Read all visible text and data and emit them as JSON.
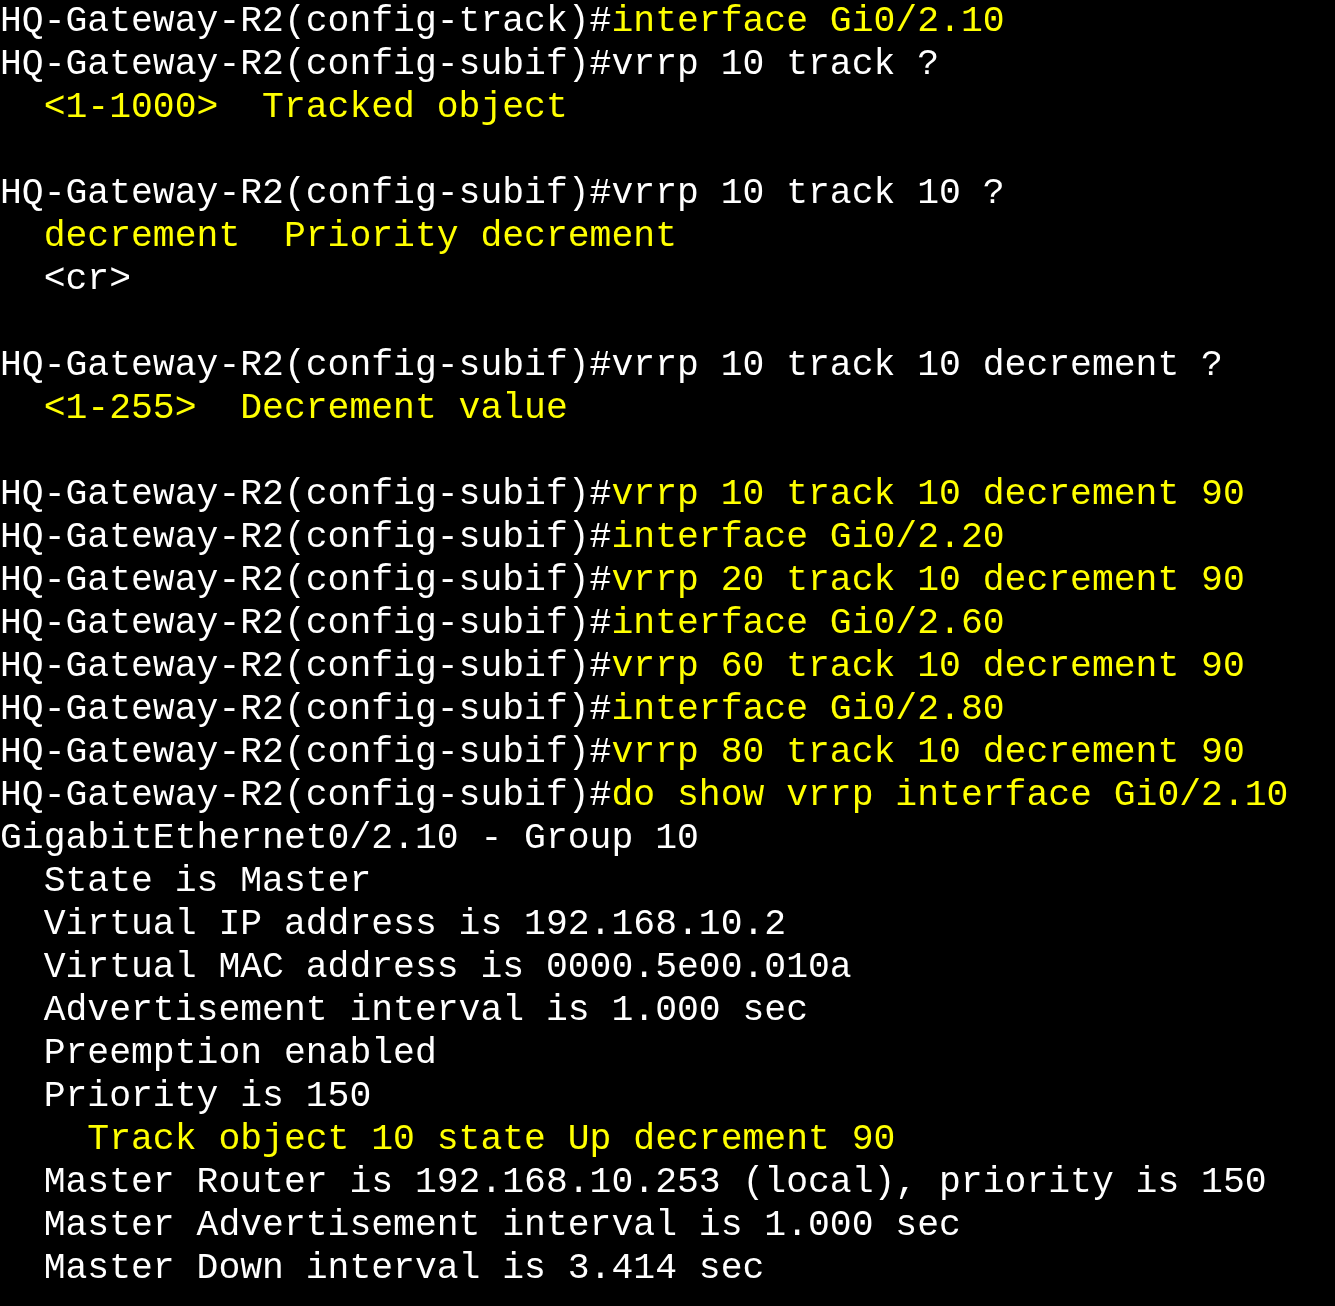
{
  "terminal": {
    "lines": [
      {
        "kind": "command",
        "prompt": "HQ-Gateway-R2(config-track)#",
        "command": "interface Gi0/2.10",
        "highlighted": true
      },
      {
        "kind": "command",
        "prompt": "HQ-Gateway-R2(config-subif)#",
        "command": "vrrp 10 track ?",
        "highlighted": false
      },
      {
        "kind": "output",
        "text": "  <1-1000>  Tracked object",
        "highlighted": true
      },
      {
        "kind": "blank"
      },
      {
        "kind": "command",
        "prompt": "HQ-Gateway-R2(config-subif)#",
        "command": "vrrp 10 track 10 ?",
        "highlighted": false
      },
      {
        "kind": "output",
        "text": "  decrement  Priority decrement",
        "highlighted": true
      },
      {
        "kind": "output",
        "text": "  <cr>",
        "highlighted": false
      },
      {
        "kind": "blank"
      },
      {
        "kind": "command",
        "prompt": "HQ-Gateway-R2(config-subif)#",
        "command": "vrrp 10 track 10 decrement ?",
        "highlighted": false
      },
      {
        "kind": "output",
        "text": "  <1-255>  Decrement value",
        "highlighted": true
      },
      {
        "kind": "blank"
      },
      {
        "kind": "command",
        "prompt": "HQ-Gateway-R2(config-subif)#",
        "command": "vrrp 10 track 10 decrement 90",
        "highlighted": true
      },
      {
        "kind": "command",
        "prompt": "HQ-Gateway-R2(config-subif)#",
        "command": "interface Gi0/2.20",
        "highlighted": true
      },
      {
        "kind": "command",
        "prompt": "HQ-Gateway-R2(config-subif)#",
        "command": "vrrp 20 track 10 decrement 90",
        "highlighted": true
      },
      {
        "kind": "command",
        "prompt": "HQ-Gateway-R2(config-subif)#",
        "command": "interface Gi0/2.60",
        "highlighted": true
      },
      {
        "kind": "command",
        "prompt": "HQ-Gateway-R2(config-subif)#",
        "command": "vrrp 60 track 10 decrement 90",
        "highlighted": true
      },
      {
        "kind": "command",
        "prompt": "HQ-Gateway-R2(config-subif)#",
        "command": "interface Gi0/2.80",
        "highlighted": true
      },
      {
        "kind": "command",
        "prompt": "HQ-Gateway-R2(config-subif)#",
        "command": "vrrp 80 track 10 decrement 90",
        "highlighted": true
      },
      {
        "kind": "command",
        "prompt": "HQ-Gateway-R2(config-subif)#",
        "command": "do show vrrp interface Gi0/2.10",
        "highlighted": true
      },
      {
        "kind": "output",
        "text": "GigabitEthernet0/2.10 - Group 10",
        "highlighted": false
      },
      {
        "kind": "output",
        "text": "  State is Master",
        "highlighted": false
      },
      {
        "kind": "output",
        "text": "  Virtual IP address is 192.168.10.2",
        "highlighted": false
      },
      {
        "kind": "output",
        "text": "  Virtual MAC address is 0000.5e00.010a",
        "highlighted": false
      },
      {
        "kind": "output",
        "text": "  Advertisement interval is 1.000 sec",
        "highlighted": false
      },
      {
        "kind": "output",
        "text": "  Preemption enabled",
        "highlighted": false
      },
      {
        "kind": "output",
        "text": "  Priority is 150",
        "highlighted": false
      },
      {
        "kind": "output",
        "text": "    Track object 10 state Up decrement 90",
        "highlighted": true
      },
      {
        "kind": "output",
        "text": "  Master Router is 192.168.10.253 (local), priority is 150",
        "highlighted": false
      },
      {
        "kind": "output",
        "text": "  Master Advertisement interval is 1.000 sec",
        "highlighted": false
      },
      {
        "kind": "output",
        "text": "  Master Down interval is 3.414 sec",
        "highlighted": false
      }
    ]
  }
}
